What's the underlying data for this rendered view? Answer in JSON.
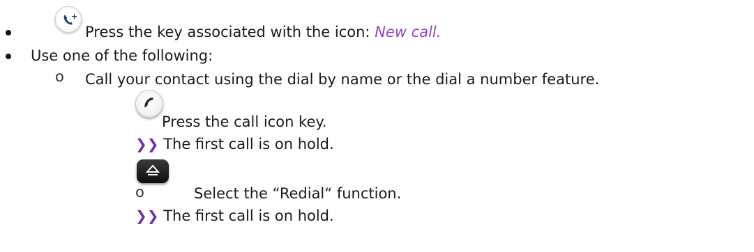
{
  "steps": {
    "step1": {
      "icon": "new-call-icon",
      "text_prefix": "Press the key associated with the icon: ",
      "emphasis": "New call."
    },
    "step2": {
      "text": "Use one of the following:"
    },
    "options": [
      {
        "text": "Call your contact using the dial by name or the dial a number feature.",
        "sub_icon": "call-icon",
        "sub_text": "Press the call icon key.",
        "result_marker": "❯❯",
        "result": "The first call is on hold."
      },
      {
        "icon": "redial-icon",
        "text": "Select the “Redial“ function.",
        "result_marker": "❯❯",
        "result": "The first call is on hold."
      }
    ]
  },
  "colors": {
    "accent": "#8e44c5",
    "result_marker": "#6b2fa6",
    "text": "#1a1a1a"
  }
}
